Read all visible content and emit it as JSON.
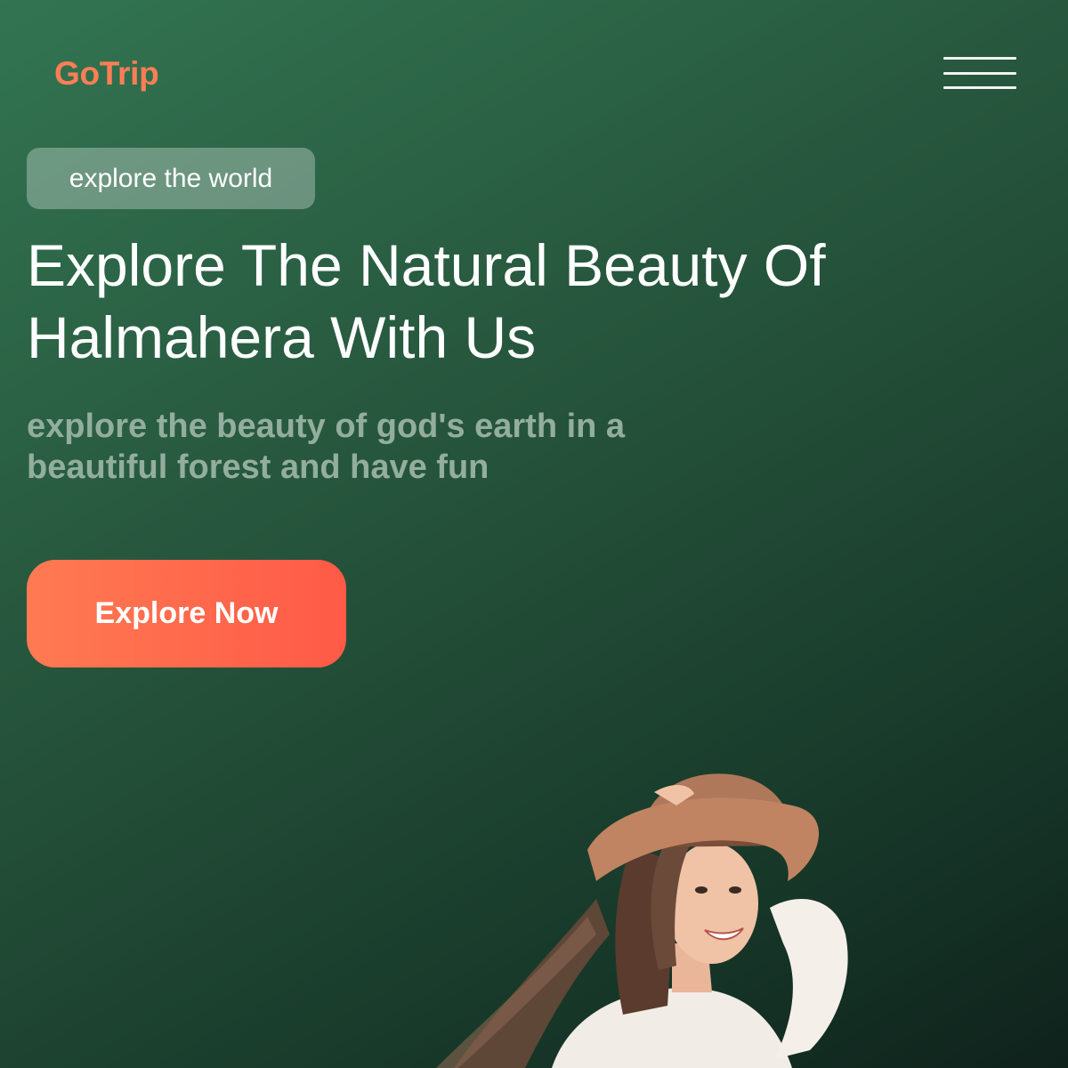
{
  "brand": {
    "name": "GoTrip",
    "color": "#ff7e55"
  },
  "header": {
    "menu_icon": "hamburger-menu-icon"
  },
  "hero": {
    "tag": "explore the world",
    "headline_line1": "Explore The Natural Beauty Of",
    "headline_line2": "Halmahera With Us",
    "subtext_line1": "explore the beauty of god's earth in a",
    "subtext_line2": "beautiful forest and have fun",
    "cta_label": "Explore Now",
    "image": "woman-with-hat-photo"
  },
  "colors": {
    "accent": "#ff6b4f",
    "background_start": "#327552",
    "background_end": "#0f221c",
    "subtext": "#93ae9e"
  }
}
